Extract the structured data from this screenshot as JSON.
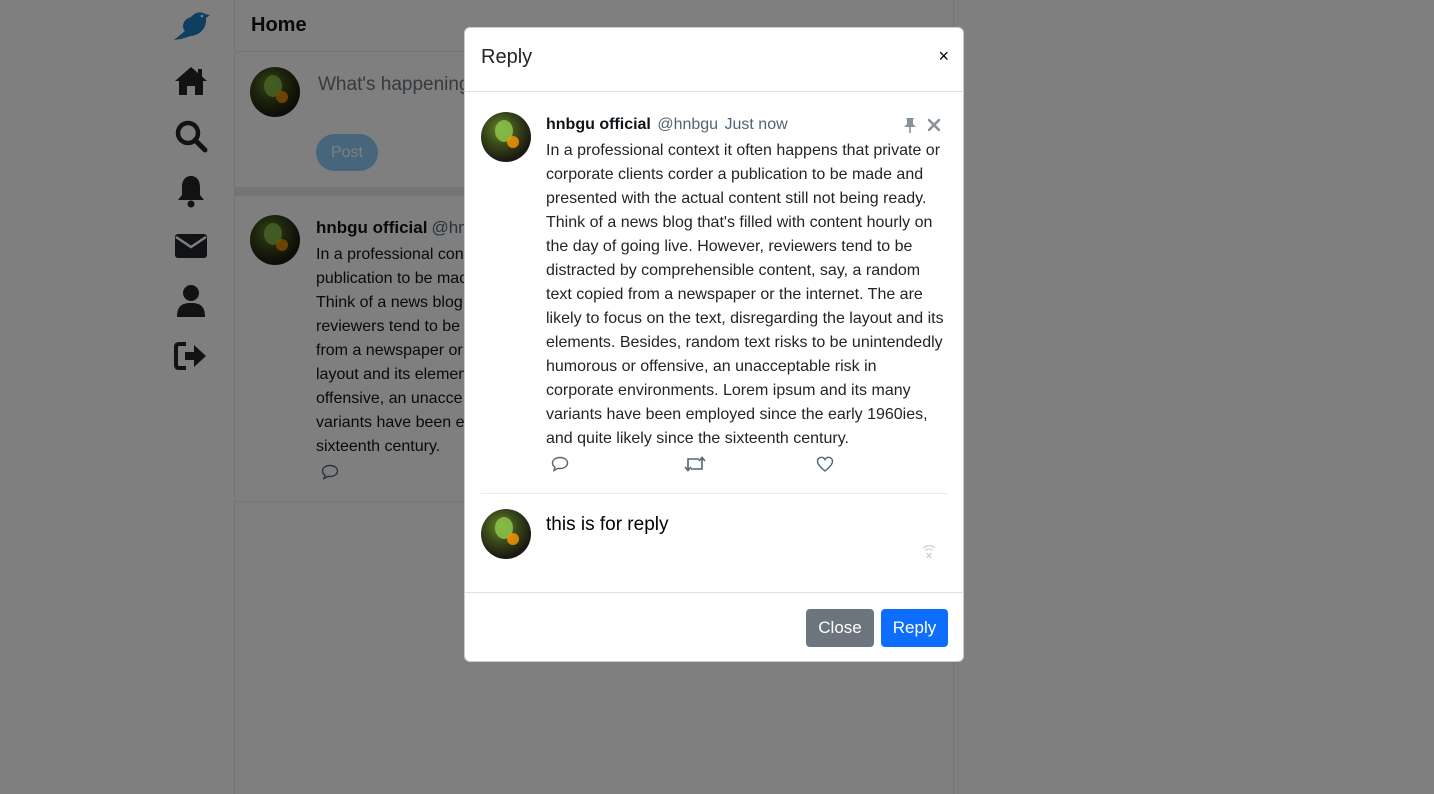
{
  "nav": {
    "items": [
      "logo",
      "home",
      "search",
      "notifications",
      "messages",
      "profile",
      "logout"
    ]
  },
  "home": {
    "title": "Home",
    "compose_placeholder": "What's happening",
    "post_label": "Post"
  },
  "feed": {
    "post": {
      "name": "hnbgu official",
      "handle": "@hnb",
      "lines": [
        "In a professional cont",
        "publication to be mad",
        "Think of a news blog",
        "reviewers tend to be",
        "from a newspaper or",
        "layout and its elemen",
        "offensive, an unacce",
        "variants have been e",
        "sixteenth century."
      ]
    }
  },
  "modal": {
    "title": "Reply",
    "close_symbol": "×",
    "tweet": {
      "name": "hnbgu official",
      "handle": "@hnbgu",
      "time": "Just now",
      "text": "In a professional context it often happens that private or corporate clients corder a publication to be made and presented with the actual content still not being ready. Think of a news blog that's filled with content hourly on the day of going live. However, reviewers tend to be distracted by comprehensible content, say, a random text copied from a newspaper or the internet. The are likely to focus on the text, disregarding the layout and its elements. Besides, random text risks to be unintendedly humorous or offensive, an unacceptable risk in corporate environments. Lorem ipsum and its many variants have been employed since the early 1960ies, and quite likely since the sixteenth century."
    },
    "reply_value": "this is for reply",
    "footer": {
      "close_label": "Close",
      "reply_label": "Reply"
    }
  },
  "colors": {
    "brand": "#1d9bf0",
    "primary_button": "#0d6efd",
    "secondary_button": "#6c757d",
    "post_button": "#8ecdf8"
  }
}
